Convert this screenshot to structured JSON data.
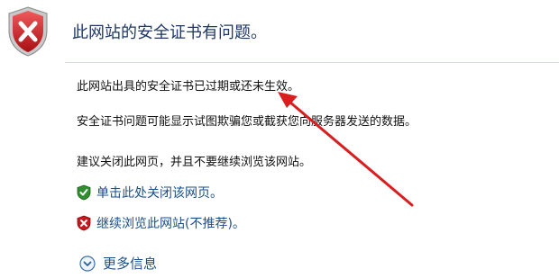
{
  "title": "此网站的安全证书有问题。",
  "paragraphs": {
    "expired": "此网站出具的安全证书已过期或还未生效。",
    "risk": "安全证书问题可能显示试图欺骗您或截获您向服务器发送的数据。",
    "advice": "建议关闭此网页，并且不要继续浏览该网站。"
  },
  "options": {
    "close": "单击此处关闭该网页。",
    "continue": "继续浏览此网站(不推荐)。"
  },
  "more_info": "更多信息",
  "icons": {
    "header": "error-shield-icon",
    "close": "green-check-shield-icon",
    "continue": "red-x-shield-icon",
    "more": "expand-circle-icon"
  },
  "colors": {
    "title": "#1f3763",
    "link": "#1b4f8a",
    "annotation_arrow": "#d81e1e",
    "error_red": "#c8191e",
    "ok_green": "#2f8f2f"
  }
}
